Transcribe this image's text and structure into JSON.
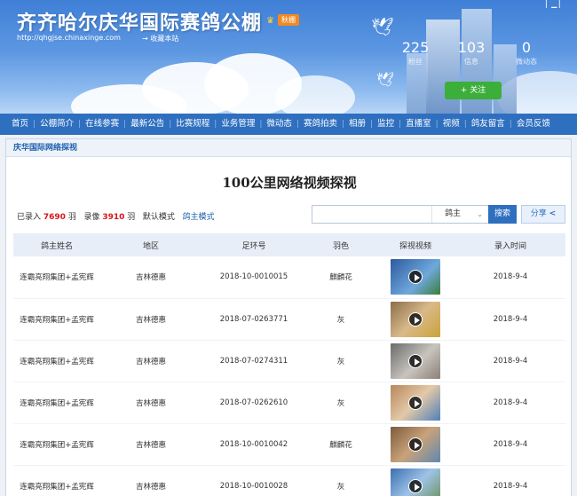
{
  "header": {
    "title": "齐齐哈尔庆华国际赛鸽公棚",
    "vip_badge": "秋棚",
    "url": "http://qhgjse.chinaxinge.com",
    "favorite": "收藏本站",
    "stats": [
      {
        "num": "225",
        "label": "粉丝"
      },
      {
        "num": "103",
        "label": "信息"
      },
      {
        "num": "0",
        "label": "微动态"
      }
    ],
    "follow": "+ 关注"
  },
  "nav": [
    "首页",
    "公棚简介",
    "在线参赛",
    "最新公告",
    "比赛规程",
    "业务管理",
    "微动态",
    "赛鸽拍卖",
    "相册",
    "监控",
    "直播室",
    "视频",
    "鸽友留言",
    "会员反馈"
  ],
  "panel": {
    "breadcrumb": "庆华国际网络探视",
    "heading": "100公里网络视频探视",
    "counts": {
      "entered_label": "已录入",
      "entered": "7690",
      "unit1": "羽",
      "shown_label": "录像",
      "shown": "3910",
      "unit2": "羽",
      "mode_label": "默认模式",
      "mode_link": "鸽主模式"
    },
    "search": {
      "placeholder": "",
      "select": "鸽主",
      "button": "搜索",
      "share": "分享"
    }
  },
  "table": {
    "headers": [
      "鸽主姓名",
      "地区",
      "足环号",
      "羽色",
      "探视视频",
      "录入时间"
    ],
    "rows": [
      {
        "owner": "连霸亮翔集团+孟宪辉",
        "region": "吉林德惠",
        "ring": "2018-10-0010015",
        "color": "麒麟花",
        "date": "2018-9-4"
      },
      {
        "owner": "连霸亮翔集团+孟宪辉",
        "region": "吉林德惠",
        "ring": "2018-07-0263771",
        "color": "灰",
        "date": "2018-9-4"
      },
      {
        "owner": "连霸亮翔集团+孟宪辉",
        "region": "吉林德惠",
        "ring": "2018-07-0274311",
        "color": "灰",
        "date": "2018-9-4"
      },
      {
        "owner": "连霸亮翔集团+孟宪辉",
        "region": "吉林德惠",
        "ring": "2018-07-0262610",
        "color": "灰",
        "date": "2018-9-4"
      },
      {
        "owner": "连霸亮翔集团+孟宪辉",
        "region": "吉林德惠",
        "ring": "2018-10-0010042",
        "color": "麒麟花",
        "date": "2018-9-4"
      },
      {
        "owner": "连霸亮翔集团+孟宪辉",
        "region": "吉林德惠",
        "ring": "2018-10-0010028",
        "color": "灰",
        "date": "2018-9-4"
      }
    ]
  },
  "colors": {
    "nav_bg": "#2f6fbf",
    "count_red": "#d8141b",
    "follow_green": "#3cae3a"
  }
}
